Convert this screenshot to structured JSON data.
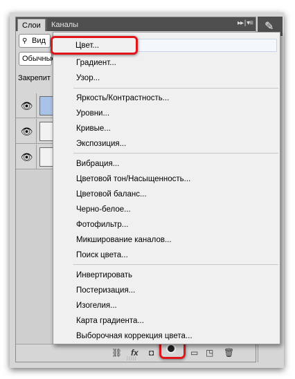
{
  "panel": {
    "tabs": [
      "Слои",
      "Каналы"
    ],
    "tab_controls": "▸▸ | ▾≡",
    "filter_label": "Вид",
    "blend_mode": "Обычные",
    "lock_label": "Закрепит"
  },
  "menu": {
    "group1": [
      "Цвет...",
      "Градиент...",
      "Узор..."
    ],
    "group2": [
      "Яркость/Контрастность...",
      "Уровни...",
      "Кривые...",
      "Экспозиция..."
    ],
    "group3": [
      "Вибрация...",
      "Цветовой тон/Насыщенность...",
      "Цветовой баланс...",
      "Черно-белое...",
      "Фотофильтр...",
      "Микширование каналов...",
      "Поиск цвета..."
    ],
    "group4": [
      "Инвертировать",
      "Постеризация...",
      "Изогелия...",
      "Карта градиента...",
      "Выборочная коррекция цвета..."
    ]
  },
  "bottom_bar": {
    "link": "⛓",
    "fx": "fx",
    "mask": "◘",
    "new_group": "▭",
    "new_layer": "◳",
    "delete": "🗑"
  },
  "icons": {
    "eye": "👁",
    "pen": "✎"
  },
  "colors": {
    "highlight": "#e0161b",
    "tabbar": "#4f4f4f",
    "panel": "#d6d6d6",
    "menu": "#f0f0f0"
  }
}
